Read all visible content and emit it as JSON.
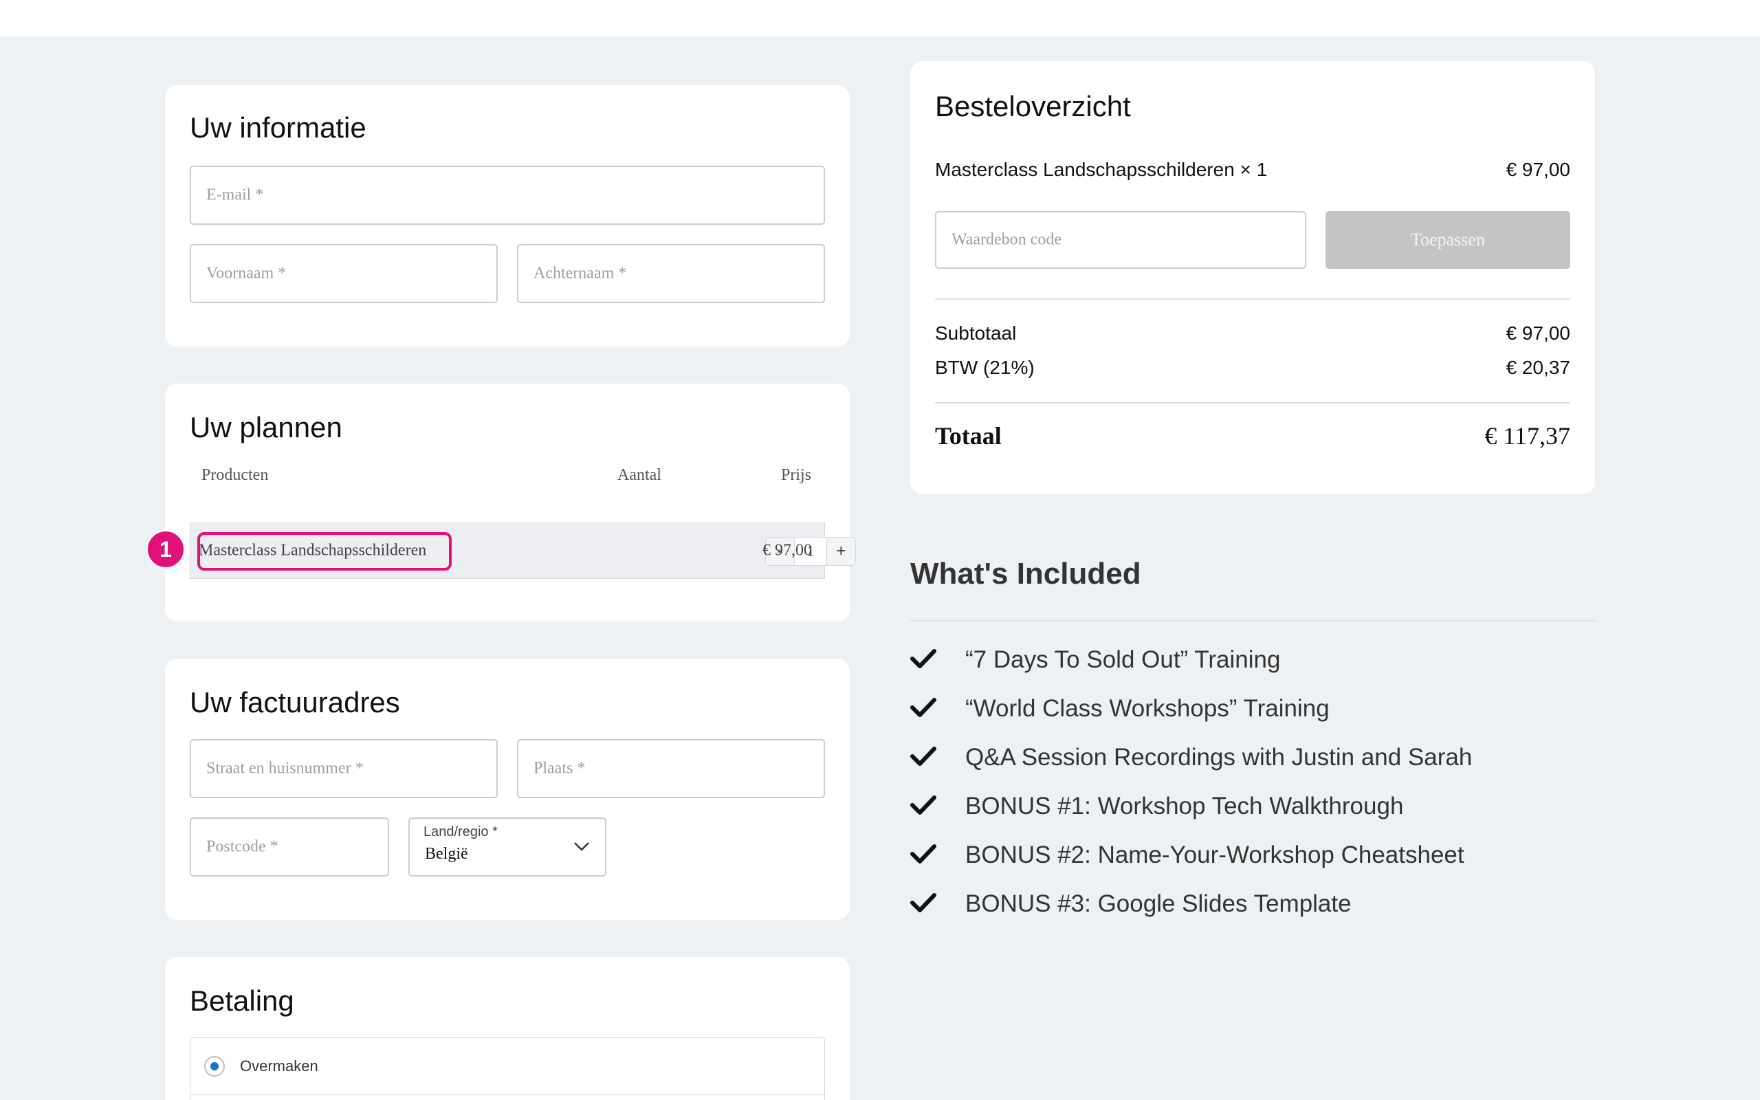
{
  "info": {
    "title": "Uw informatie",
    "email_placeholder": "E-mail *",
    "first_name_placeholder": "Voornaam *",
    "last_name_placeholder": "Achternaam *"
  },
  "plans": {
    "title": "Uw plannen",
    "col_products": "Producten",
    "col_quantity": "Aantal",
    "col_price": "Prijs",
    "product": {
      "name": "Masterclass Landschapsschilderen",
      "quantity": "1",
      "price": "€ 97,00",
      "minus": "-",
      "plus": "+"
    },
    "annotation_badge": "1"
  },
  "billing": {
    "title": "Uw factuuradres",
    "street_placeholder": "Straat en huisnummer *",
    "city_placeholder": "Plaats *",
    "postcode_placeholder": "Postcode *",
    "country_label": "Land/regio *",
    "country_value": "België"
  },
  "payment": {
    "title": "Betaling",
    "option_label": "Overmaken"
  },
  "summary": {
    "title": "Besteloverzicht",
    "line_item": "Masterclass Landschapsschilderen × 1",
    "line_price": "€ 97,00",
    "voucher_placeholder": "Waardebon code",
    "apply_label": "Toepassen",
    "subtotal_label": "Subtotaal",
    "subtotal_value": "€ 97,00",
    "vat_label": "BTW (21%)",
    "vat_value": "€ 20,37",
    "total_label": "Totaal",
    "total_value": "€ 117,37"
  },
  "included": {
    "title": "What's Included",
    "items": [
      "“7 Days To Sold Out” Training",
      "“World Class Workshops” Training",
      "Q&A Session Recordings with Justin and Sarah",
      "BONUS #1: Workshop Tech Walkthrough",
      "BONUS #2: Name-Your-Workshop Cheatsheet",
      "BONUS #3: Google Slides Template"
    ]
  },
  "colors": {
    "accent_pink": "#e0127a",
    "radio_blue": "#1a73c9",
    "disabled_button": "#c4c4c4"
  }
}
